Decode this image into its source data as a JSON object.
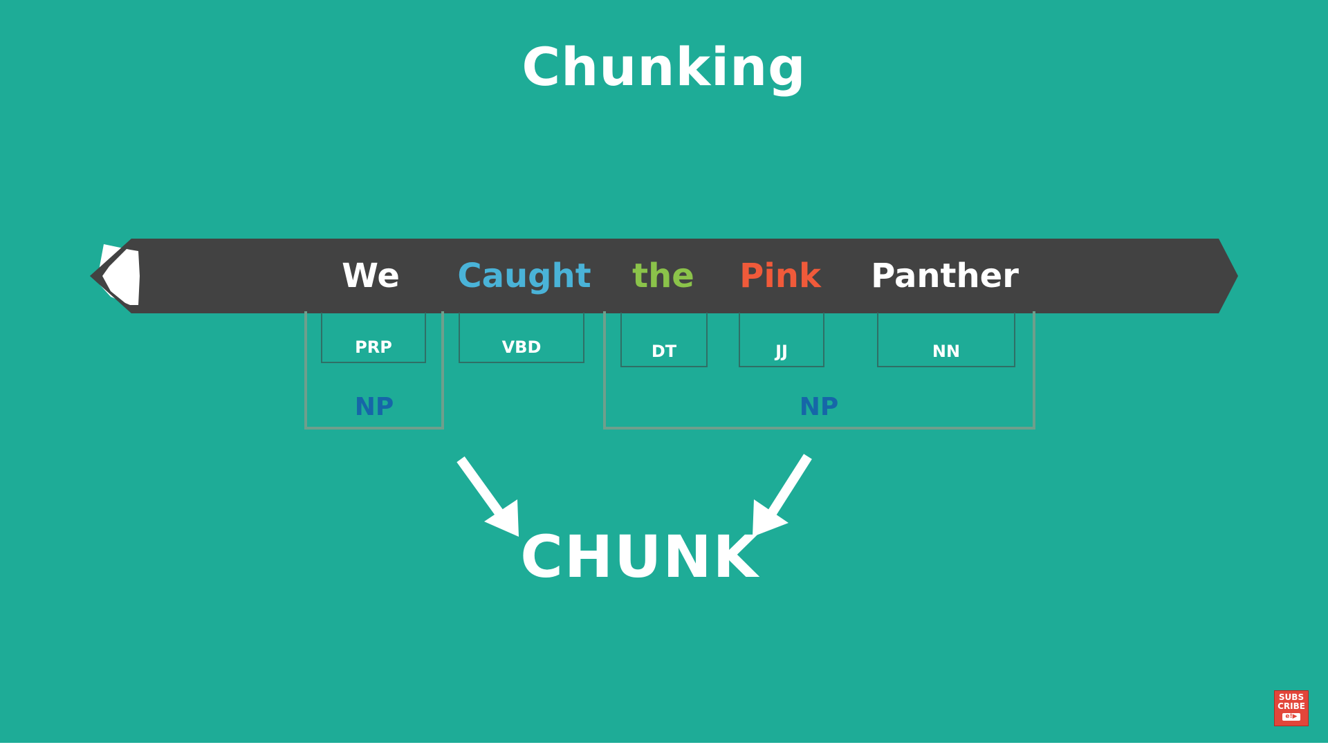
{
  "slide": {
    "title": "Chunking"
  },
  "sentence": {
    "words": [
      {
        "text": "We",
        "color": "#ffffff"
      },
      {
        "text": "Caught",
        "color": "#4ab3d8"
      },
      {
        "text": "the",
        "color": "#8bc34a"
      },
      {
        "text": "Pink",
        "color": "#f05a3a"
      },
      {
        "text": "Panther",
        "color": "#ffffff"
      }
    ]
  },
  "tags": [
    "PRP",
    "VBD",
    "DT",
    "JJ",
    "NN"
  ],
  "chunks": [
    {
      "label": "NP"
    },
    {
      "label": "NP"
    }
  ],
  "result_label": "CHUNK",
  "badge": {
    "line1": "SUBS",
    "line2": "CRIBE",
    "line3": "e!▶"
  },
  "colors": {
    "background": "#1eac97",
    "pencil_body": "#424242",
    "np_label": "#1666a8",
    "chunk_border": "#6f9f8c",
    "badge": "#e2463a"
  },
  "icons": [
    "pencil-icon",
    "arrow-down-right-icon",
    "arrow-down-left-icon",
    "subscribe-badge-icon"
  ]
}
